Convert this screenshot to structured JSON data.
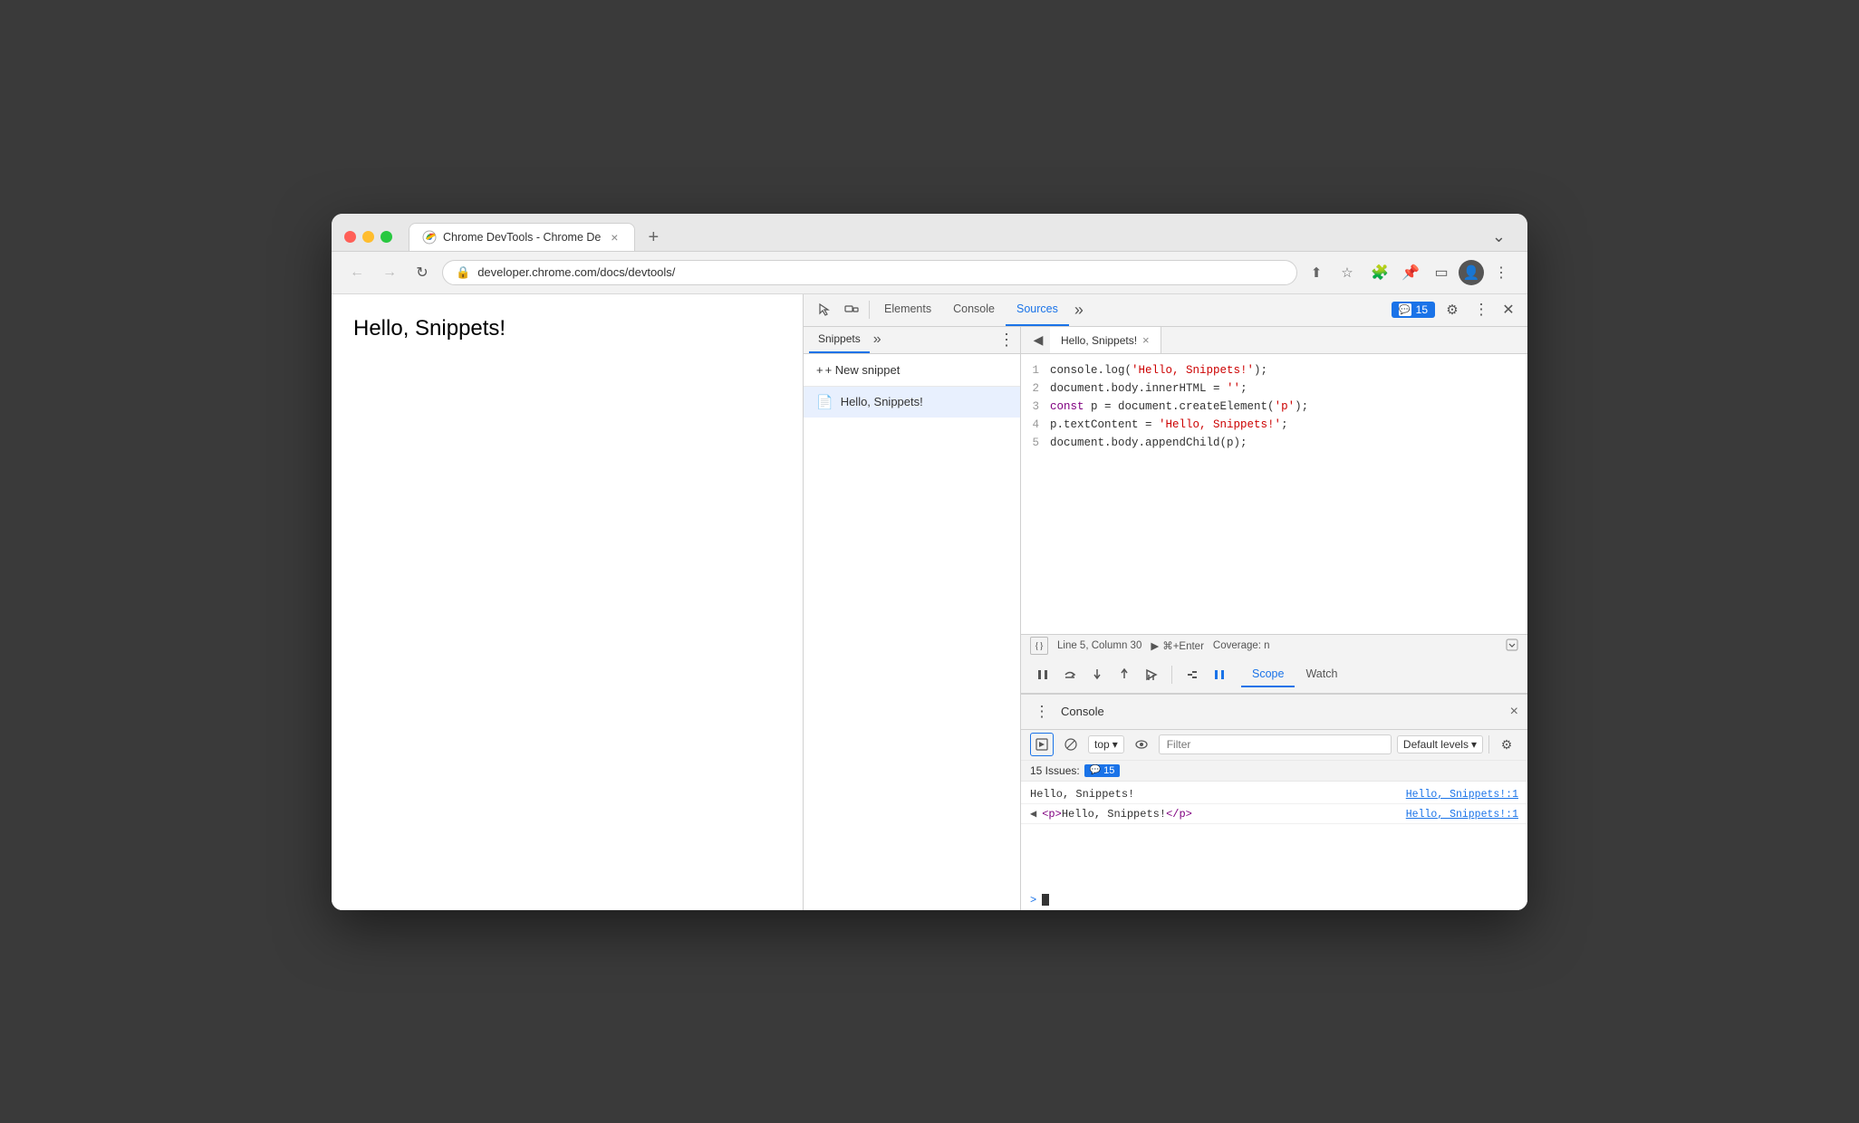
{
  "browser": {
    "tab_title": "Chrome DevTools - Chrome De",
    "url": "developer.chrome.com/docs/devtools/",
    "new_tab_label": "+",
    "tab_overflow_label": "⌄"
  },
  "page": {
    "hello_text": "Hello, Snippets!"
  },
  "devtools": {
    "tabs": [
      "Elements",
      "Console",
      "Sources"
    ],
    "active_tab": "Sources",
    "more_tabs": "»",
    "issues_count": "15",
    "settings_label": "⚙",
    "menu_label": "⋮",
    "close_label": "×"
  },
  "snippets_panel": {
    "tab_label": "Snippets",
    "more_label": "»",
    "menu_label": "⋮",
    "new_snippet_label": "+ New snippet",
    "items": [
      {
        "name": "Hello, Snippets!",
        "icon": "📄"
      }
    ]
  },
  "editor": {
    "tab_name": "Hello, Snippets!",
    "close_label": "×",
    "lines": [
      {
        "num": 1,
        "code": "console.log('Hello, Snippets!');",
        "parts": [
          {
            "text": "console.log(",
            "type": "normal"
          },
          {
            "text": "'Hello, Snippets!'",
            "type": "string"
          },
          {
            "text": ");",
            "type": "normal"
          }
        ]
      },
      {
        "num": 2,
        "code": "document.body.innerHTML = '';",
        "parts": [
          {
            "text": "document.body.innerHTML = ",
            "type": "normal"
          },
          {
            "text": "''",
            "type": "string"
          },
          {
            "text": ";",
            "type": "normal"
          }
        ]
      },
      {
        "num": 3,
        "code": "const p = document.createElement('p');",
        "parts": [
          {
            "text": "const",
            "type": "keyword"
          },
          {
            "text": " p = document.createElement(",
            "type": "normal"
          },
          {
            "text": "'p'",
            "type": "string"
          },
          {
            "text": ");",
            "type": "normal"
          }
        ]
      },
      {
        "num": 4,
        "code": "p.textContent = 'Hello, Snippets!';",
        "parts": [
          {
            "text": "p.textContent = ",
            "type": "normal"
          },
          {
            "text": "'Hello, Snippets!'",
            "type": "string"
          },
          {
            "text": ";",
            "type": "normal"
          }
        ]
      },
      {
        "num": 5,
        "code": "document.body.appendChild(p);",
        "parts": [
          {
            "text": "document.body.appendChild(p);",
            "type": "normal"
          }
        ]
      }
    ],
    "status_bar": {
      "pretty_print": "{}",
      "position": "Line 5, Column 30",
      "run_label": "▶ ⌘+Enter",
      "coverage_label": "Coverage: n"
    }
  },
  "debugger": {
    "buttons": [
      "⏸",
      "↺",
      "⬇",
      "⬆",
      "⇥"
    ],
    "right_buttons": [
      "⛔",
      "⏸"
    ],
    "scope_tabs": [
      "Scope",
      "Watch"
    ],
    "active_scope": "Scope"
  },
  "console": {
    "title": "Console",
    "close_label": "×",
    "toolbar": {
      "execute_label": "▶",
      "block_label": "🚫",
      "context_label": "top",
      "context_arrow": "▾",
      "eye_label": "👁",
      "filter_placeholder": "Filter",
      "levels_label": "Default levels",
      "levels_arrow": "▾",
      "settings_label": "⚙"
    },
    "issues_label": "15 Issues:",
    "issues_count": "15",
    "output": [
      {
        "type": "log",
        "text": "Hello, Snippets!",
        "source": "Hello, Snippets!:1"
      },
      {
        "type": "element",
        "text": "<p>Hello, Snippets!</p>",
        "source": "Hello, Snippets!:1"
      }
    ],
    "input_prompt": ">"
  }
}
